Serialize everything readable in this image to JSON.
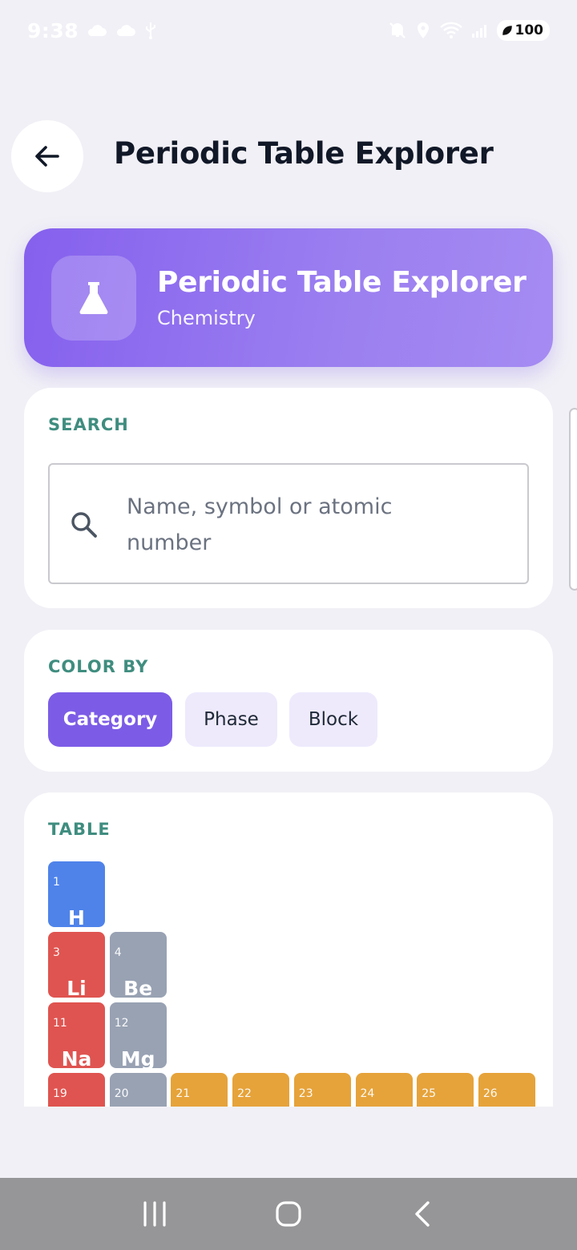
{
  "status": {
    "time": "9:38",
    "battery": "100",
    "icons": [
      "cloud-icon",
      "cloud-icon",
      "usb-icon",
      "mute-icon",
      "location-icon",
      "wifi-icon",
      "signal-icon",
      "battery-icon"
    ]
  },
  "app_bar": {
    "title": "Periodic Table Explorer",
    "back_icon": "arrow-left-icon"
  },
  "hero": {
    "title": "Periodic Table Explorer",
    "subtitle": "Chemistry",
    "icon": "flask-icon"
  },
  "search": {
    "label": "SEARCH",
    "placeholder": "Name, symbol or atomic number",
    "icon": "search-icon"
  },
  "color_by": {
    "label": "COLOR BY",
    "options": [
      {
        "label": "Category",
        "active": true
      },
      {
        "label": "Phase",
        "active": false
      },
      {
        "label": "Block",
        "active": false
      }
    ]
  },
  "table": {
    "label": "TABLE",
    "colors": {
      "nonmetal": "#4f83ea",
      "alkali": "#df5450",
      "alkaline": "#98a2b3",
      "transition": "#e6a33a"
    },
    "elements": [
      {
        "num": "1",
        "sym": "H",
        "group": 1,
        "period": 1,
        "cat": "nonmetal"
      },
      {
        "num": "3",
        "sym": "Li",
        "group": 1,
        "period": 2,
        "cat": "alkali"
      },
      {
        "num": "4",
        "sym": "Be",
        "group": 2,
        "period": 2,
        "cat": "alkaline"
      },
      {
        "num": "11",
        "sym": "Na",
        "group": 1,
        "period": 3,
        "cat": "alkali"
      },
      {
        "num": "12",
        "sym": "Mg",
        "group": 2,
        "period": 3,
        "cat": "alkaline"
      },
      {
        "num": "19",
        "sym": "",
        "group": 1,
        "period": 4,
        "cat": "alkali"
      },
      {
        "num": "20",
        "sym": "",
        "group": 2,
        "period": 4,
        "cat": "alkaline"
      },
      {
        "num": "21",
        "sym": "",
        "group": 3,
        "period": 4,
        "cat": "transition"
      },
      {
        "num": "22",
        "sym": "",
        "group": 4,
        "period": 4,
        "cat": "transition"
      },
      {
        "num": "23",
        "sym": "",
        "group": 5,
        "period": 4,
        "cat": "transition"
      },
      {
        "num": "24",
        "sym": "",
        "group": 6,
        "period": 4,
        "cat": "transition"
      },
      {
        "num": "25",
        "sym": "",
        "group": 7,
        "period": 4,
        "cat": "transition"
      },
      {
        "num": "26",
        "sym": "",
        "group": 8,
        "period": 4,
        "cat": "transition"
      }
    ]
  },
  "nav": {
    "recents_icon": "recents-icon",
    "home_icon": "home-icon",
    "back_icon": "back-icon"
  }
}
